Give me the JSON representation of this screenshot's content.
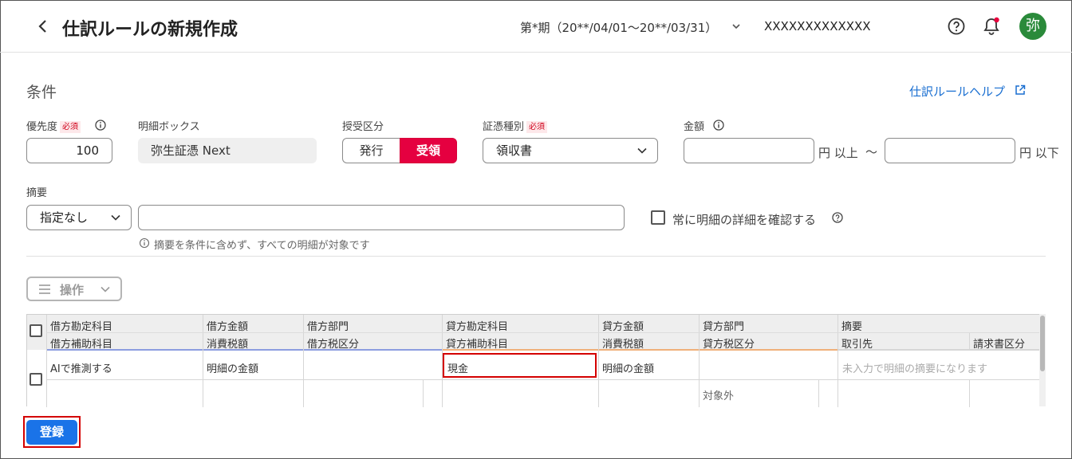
{
  "header": {
    "title": "仕訳ルールの新規作成",
    "period": "第*期（20**/04/01〜20**/03/31）",
    "company": "XXXXXXXXXXXXX",
    "avatar": "弥"
  },
  "conditions": {
    "section_title": "条件",
    "help_link": "仕訳ルールヘルプ",
    "priority": {
      "label": "優先度",
      "required": "必須",
      "value": "100"
    },
    "mailbox": {
      "label": "明細ボックス",
      "value": "弥生証憑 Next"
    },
    "direction": {
      "label": "授受区分",
      "issue": "発行",
      "receive": "受領",
      "selected": "受領"
    },
    "doc_type": {
      "label": "証憑種別",
      "required": "必須",
      "value": "領収書"
    },
    "amount": {
      "label": "金額",
      "min_value": "",
      "max_value": "",
      "min_unit": "円 以上",
      "separator": "〜",
      "max_unit": "円 以下"
    },
    "summary": {
      "label": "摘要",
      "mode": "指定なし",
      "value": "",
      "hint": "摘要を条件に含めず、すべての明細が対象です"
    },
    "always_confirm": {
      "label": "常に明細の詳細を確認する",
      "checked": false
    }
  },
  "operations": {
    "label": "操作"
  },
  "table": {
    "header_row1": [
      "借方勘定科目",
      "借方金額",
      "借方部門",
      "貸方勘定科目",
      "貸方金額",
      "貸方部門",
      "摘要"
    ],
    "header_row2": [
      "借方補助科目",
      "消費税額",
      "借方税区分",
      "貸方補助科目",
      "消費税額",
      "貸方税区分",
      "取引先",
      "請求書区分"
    ],
    "row1": {
      "debit_account": "AIで推測する",
      "debit_amount": "明細の金額",
      "debit_dept": "",
      "credit_account": "現金",
      "credit_amount": "明細の金額",
      "credit_dept": "",
      "summary_placeholder": "未入力で明細の摘要になります"
    },
    "row2": {
      "credit_tax_category": "対象外"
    }
  },
  "footer": {
    "register_label": "登録"
  },
  "colors": {
    "accent_blue": "#1a73e8",
    "receive_red": "#e50040",
    "avatar_green": "#2a8a3a",
    "highlight_red": "#d40000",
    "debit_underline": "#8c9de0",
    "credit_underline": "#f0b07a"
  }
}
